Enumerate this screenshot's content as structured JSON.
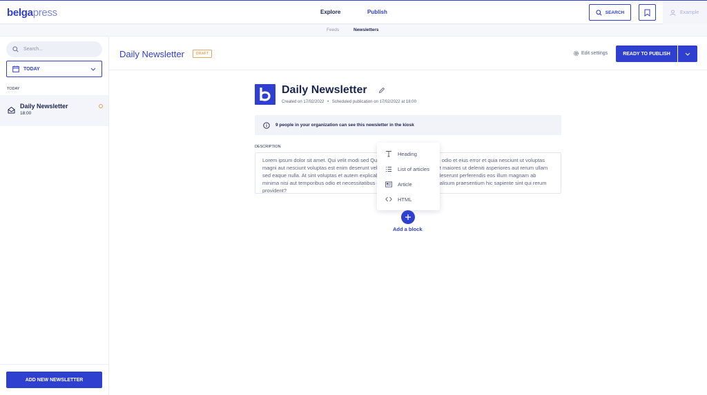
{
  "brand": {
    "logo_bold": "belga",
    "logo_light": "press"
  },
  "topnav": {
    "explore": "Explore",
    "publish": "Publish",
    "search_label": "SEARCH",
    "user_name": "Example"
  },
  "subnav": {
    "feeds": "Feeds",
    "newsletters": "Newsletters"
  },
  "sidebar": {
    "search_placeholder": "Search...",
    "date_filter": "TODAY",
    "group_label": "TODAY",
    "items": [
      {
        "name": "Daily Newsletter",
        "time": "18:00"
      }
    ],
    "add_button": "ADD NEW NEWSLETTER"
  },
  "header": {
    "title": "Daily Newsletter",
    "status_badge": "DRAFT",
    "edit_settings": "Edit settings",
    "publish_button": "READY TO PUBLISH"
  },
  "newsletter": {
    "logo_letter": "b",
    "title": "Daily Newsletter",
    "created": "Created on 17/02/2022",
    "separator": "•",
    "scheduled": "Scheduled publication on 17/02/2022 at 18:00",
    "info": "9 people in your organization can see this newsletter in the kiosk",
    "description_label": "DESCRIPTION",
    "description": "Lorem ipsum dolor sit amet. Qui velit modi sed Quia architecto qui voluptatem odio et eius error et quia nesciunt ut voluptas magni aut nesciunt voluptas est enim deserunt vel amet atque a reprehenderit maiores ut deleniti asperiores aut rerum ullam sed eaque nulla. At sint voluptas et autem explicabo ex reiciendis autem. Sit deserunt perferendis eos illum magnam ab minima nisi aut temporibus odio et necessitatibus quasi. Sit corrupti quae ut galisum praesentium hic sapiente sint qui rerum provident?"
  },
  "block_menu": {
    "items": [
      {
        "label": "Heading",
        "icon": "heading-icon"
      },
      {
        "label": "List of articles",
        "icon": "list-icon"
      },
      {
        "label": "Article",
        "icon": "article-icon"
      },
      {
        "label": "HTML",
        "icon": "code-icon"
      }
    ],
    "add_block": "Add a block"
  },
  "colors": {
    "accent": "#2f3fcf",
    "draft": "#f0a35b",
    "text": "#1b2450"
  }
}
